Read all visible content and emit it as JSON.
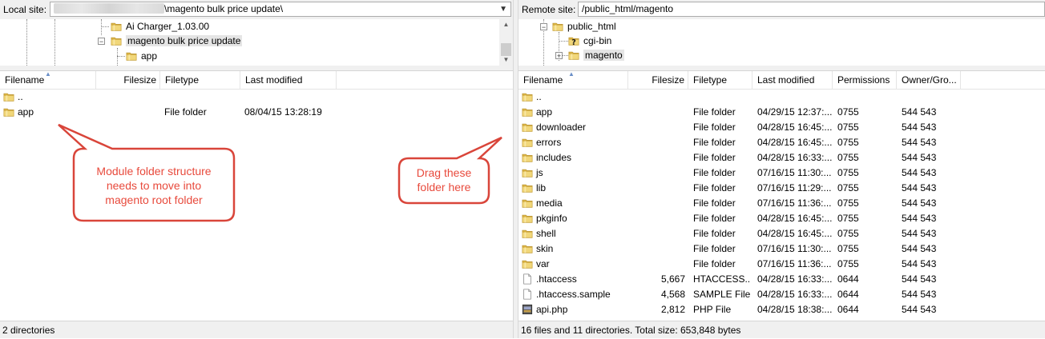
{
  "local": {
    "site_label": "Local site:",
    "path_suffix": "\\magento bulk price update\\",
    "tree": [
      {
        "label": "Ai Charger_1.03.00"
      },
      {
        "label": "magento bulk price update"
      },
      {
        "label": "app"
      }
    ],
    "columns": [
      "Filename",
      "Filesize",
      "Filetype",
      "Last modified"
    ],
    "files": [
      {
        "name": "..",
        "size": "",
        "type": "",
        "modified": "",
        "icon": "folder-icon"
      },
      {
        "name": "app",
        "size": "",
        "type": "File folder",
        "modified": "08/04/15 13:28:19",
        "icon": "folder-icon"
      }
    ],
    "status": "2 directories"
  },
  "remote": {
    "site_label": "Remote site:",
    "path": "/public_html/magento",
    "tree": [
      {
        "label": "public_html"
      },
      {
        "label": "cgi-bin"
      },
      {
        "label": "magento"
      }
    ],
    "columns": [
      "Filename",
      "Filesize",
      "Filetype",
      "Last modified",
      "Permissions",
      "Owner/Gro..."
    ],
    "files": [
      {
        "name": "..",
        "size": "",
        "type": "",
        "modified": "",
        "perms": "",
        "owner": "",
        "icon": "folder-icon"
      },
      {
        "name": "app",
        "size": "",
        "type": "File folder",
        "modified": "04/29/15 12:37:...",
        "perms": "0755",
        "owner": "544 543",
        "icon": "folder-icon"
      },
      {
        "name": "downloader",
        "size": "",
        "type": "File folder",
        "modified": "04/28/15 16:45:...",
        "perms": "0755",
        "owner": "544 543",
        "icon": "folder-icon"
      },
      {
        "name": "errors",
        "size": "",
        "type": "File folder",
        "modified": "04/28/15 16:45:...",
        "perms": "0755",
        "owner": "544 543",
        "icon": "folder-icon"
      },
      {
        "name": "includes",
        "size": "",
        "type": "File folder",
        "modified": "04/28/15 16:33:...",
        "perms": "0755",
        "owner": "544 543",
        "icon": "folder-icon"
      },
      {
        "name": "js",
        "size": "",
        "type": "File folder",
        "modified": "07/16/15 11:30:...",
        "perms": "0755",
        "owner": "544 543",
        "icon": "folder-icon"
      },
      {
        "name": "lib",
        "size": "",
        "type": "File folder",
        "modified": "07/16/15 11:29:...",
        "perms": "0755",
        "owner": "544 543",
        "icon": "folder-icon"
      },
      {
        "name": "media",
        "size": "",
        "type": "File folder",
        "modified": "07/16/15 11:36:...",
        "perms": "0755",
        "owner": "544 543",
        "icon": "folder-icon"
      },
      {
        "name": "pkginfo",
        "size": "",
        "type": "File folder",
        "modified": "04/28/15 16:45:...",
        "perms": "0755",
        "owner": "544 543",
        "icon": "folder-icon"
      },
      {
        "name": "shell",
        "size": "",
        "type": "File folder",
        "modified": "04/28/15 16:45:...",
        "perms": "0755",
        "owner": "544 543",
        "icon": "folder-icon"
      },
      {
        "name": "skin",
        "size": "",
        "type": "File folder",
        "modified": "07/16/15 11:30:...",
        "perms": "0755",
        "owner": "544 543",
        "icon": "folder-icon"
      },
      {
        "name": "var",
        "size": "",
        "type": "File folder",
        "modified": "07/16/15 11:36:...",
        "perms": "0755",
        "owner": "544 543",
        "icon": "folder-icon"
      },
      {
        "name": ".htaccess",
        "size": "5,667",
        "type": "HTACCESS...",
        "modified": "04/28/15 16:33:...",
        "perms": "0644",
        "owner": "544 543",
        "icon": "file-icon"
      },
      {
        "name": ".htaccess.sample",
        "size": "4,568",
        "type": "SAMPLE File",
        "modified": "04/28/15 16:33:...",
        "perms": "0644",
        "owner": "544 543",
        "icon": "file-icon"
      },
      {
        "name": "api.php",
        "size": "2,812",
        "type": "PHP File",
        "modified": "04/28/15 18:38:...",
        "perms": "0644",
        "owner": "544 543",
        "icon": "php-file-icon"
      }
    ],
    "status": "16 files and 11 directories. Total size: 653,848 bytes"
  },
  "annotations": {
    "left_lines": [
      "Module folder structure",
      "needs to move into",
      "magento root folder"
    ],
    "right_lines": [
      "Drag these",
      "folder here"
    ]
  },
  "colors": {
    "callout_stroke": "#d9453a",
    "callout_text": "#e84a3c",
    "folder": "#e7c85d"
  }
}
